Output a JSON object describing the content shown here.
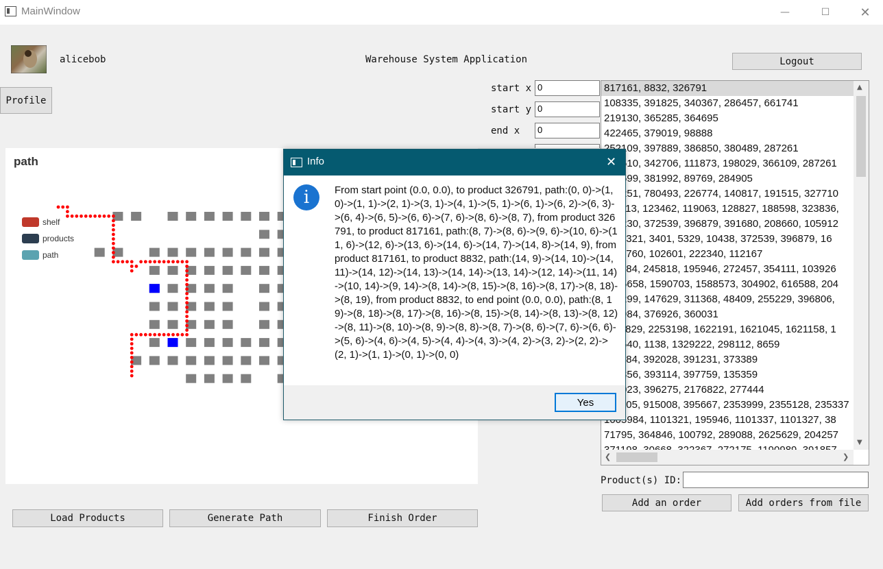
{
  "window": {
    "title": "MainWindow"
  },
  "user": {
    "name": "alicebob"
  },
  "header": {
    "app_title": "Warehouse System Application"
  },
  "buttons": {
    "logout": "Logout",
    "profile": "Profile",
    "load_products": "Load Products",
    "generate_path": "Generate Path",
    "finish_order": "Finish Order",
    "add_order": "Add an order",
    "add_orders_file": "Add orders from file"
  },
  "coords": {
    "start_x_label": "start x",
    "start_x_value": "0",
    "start_y_label": "start y",
    "start_y_value": "0",
    "end_x_label": "end x",
    "end_x_value": "0"
  },
  "product_id": {
    "label": "Product(s) ID:",
    "value": ""
  },
  "orders": [
    "817161, 8832, 326791",
    "108335, 391825, 340367, 286457, 661741",
    "219130, 365285, 364695",
    "422465, 379019, 98888",
    "252109, 397889, 386850, 380489, 287261",
    "202510, 342706, 111873, 198029, 366109, 287261",
    "301599, 381992, 89769, 284905",
    "101251, 780493, 226774, 140817, 191515, 327710",
    "101113, 123462, 119063, 128827, 188598, 323836,",
    "101230, 372539, 396879, 391680, 208660, 105912",
    "1101321, 3401, 5329, 10438, 372539, 396879, 16",
    "1197760, 102601, 222340, 112167",
    "101184, 245818, 195946, 272457, 354111, 103926",
    "1775658, 1590703, 1588573, 304902, 616588, 204",
    "101299, 147629, 311368, 48409, 255229, 396806,",
    "101984, 376926, 360031",
    "1112829, 2253198, 1622191, 1621045, 1621158, 1",
    "101540, 1138, 1329222, 298112, 8659",
    "101184, 392028, 391231, 373389",
    "101356, 393114, 397759, 135359",
    "101023, 396275, 2176822, 277444",
    "101105, 915008, 395667, 2353999, 2355128, 235337",
    "1005984, 1101321, 195946, 1101337, 1101327, 38",
    "71795, 364846, 100792, 289088, 2625629, 204257",
    "371198, 30668, 322367, 272175, 1190989, 391857"
  ],
  "chart_data": {
    "type": "scatter",
    "title": "path",
    "legend": [
      "shelf",
      "products",
      "path"
    ],
    "colors": {
      "shelf": "#808080",
      "products": "#0000ff",
      "path": "#ff0000",
      "legend_shelf": "#c0392b",
      "legend_products": "#2c3e50",
      "legend_path": "#5ba3b0"
    },
    "shelves": [
      [
        2,
        0
      ],
      [
        3,
        0
      ],
      [
        5,
        0
      ],
      [
        6,
        0
      ],
      [
        7,
        0
      ],
      [
        8,
        0
      ],
      [
        9,
        0
      ],
      [
        10,
        0
      ],
      [
        11,
        0
      ],
      [
        12,
        0
      ],
      [
        13,
        0
      ],
      [
        14,
        0
      ],
      [
        15,
        0
      ],
      [
        10,
        1
      ],
      [
        11,
        1
      ],
      [
        12,
        1
      ],
      [
        13,
        1
      ],
      [
        14,
        1
      ],
      [
        1,
        2
      ],
      [
        2,
        2
      ],
      [
        4,
        2
      ],
      [
        5,
        2
      ],
      [
        6,
        2
      ],
      [
        7,
        2
      ],
      [
        8,
        2
      ],
      [
        9,
        2
      ],
      [
        10,
        2
      ],
      [
        11,
        2
      ],
      [
        12,
        2
      ],
      [
        13,
        2
      ],
      [
        14,
        2
      ],
      [
        4,
        3
      ],
      [
        5,
        3
      ],
      [
        6,
        3
      ],
      [
        7,
        3
      ],
      [
        8,
        3
      ],
      [
        9,
        3
      ],
      [
        10,
        3
      ],
      [
        11,
        3
      ],
      [
        12,
        3
      ],
      [
        13,
        3
      ],
      [
        14,
        3
      ],
      [
        4,
        4
      ],
      [
        5,
        4
      ],
      [
        6,
        4
      ],
      [
        7,
        4
      ],
      [
        8,
        4
      ],
      [
        10,
        4
      ],
      [
        11,
        4
      ],
      [
        12,
        4
      ],
      [
        13,
        4
      ],
      [
        14,
        4
      ],
      [
        4,
        5
      ],
      [
        5,
        5
      ],
      [
        6,
        5
      ],
      [
        7,
        5
      ],
      [
        8,
        5
      ],
      [
        10,
        5
      ],
      [
        11,
        5
      ],
      [
        12,
        5
      ],
      [
        13,
        5
      ],
      [
        14,
        5
      ],
      [
        4,
        6
      ],
      [
        5,
        6
      ],
      [
        6,
        6
      ],
      [
        7,
        6
      ],
      [
        8,
        6
      ],
      [
        10,
        6
      ],
      [
        11,
        6
      ],
      [
        12,
        6
      ],
      [
        13,
        6
      ],
      [
        14,
        6
      ],
      [
        4,
        7
      ],
      [
        5,
        7
      ],
      [
        6,
        7
      ],
      [
        7,
        7
      ],
      [
        8,
        7
      ],
      [
        9,
        7
      ],
      [
        10,
        7
      ],
      [
        11,
        7
      ],
      [
        12,
        7
      ],
      [
        13,
        7
      ],
      [
        3,
        8
      ],
      [
        4,
        8
      ],
      [
        5,
        8
      ],
      [
        6,
        8
      ],
      [
        7,
        8
      ],
      [
        8,
        8
      ],
      [
        9,
        8
      ],
      [
        10,
        8
      ],
      [
        11,
        8
      ],
      [
        12,
        8
      ],
      [
        13,
        8
      ],
      [
        6,
        9
      ],
      [
        7,
        9
      ],
      [
        8,
        9
      ],
      [
        9,
        9
      ],
      [
        11,
        9
      ],
      [
        12,
        9
      ],
      [
        13,
        9
      ],
      [
        14,
        9
      ],
      [
        15,
        9
      ],
      [
        14,
        10
      ],
      [
        15,
        10
      ]
    ],
    "products": [
      [
        4,
        4
      ],
      [
        12,
        4
      ],
      [
        5,
        7
      ]
    ],
    "path": [
      [
        0,
        0
      ],
      [
        1,
        0
      ],
      [
        1,
        1
      ],
      [
        2,
        1
      ],
      [
        3,
        1
      ],
      [
        4,
        1
      ],
      [
        5,
        1
      ],
      [
        6,
        1
      ],
      [
        6,
        2
      ],
      [
        6,
        3
      ],
      [
        6,
        4
      ],
      [
        6,
        5
      ],
      [
        6,
        6
      ],
      [
        7,
        6
      ],
      [
        8,
        6
      ],
      [
        8,
        7
      ],
      [
        9,
        6
      ],
      [
        10,
        6
      ],
      [
        11,
        6
      ],
      [
        12,
        6
      ],
      [
        13,
        6
      ],
      [
        14,
        6
      ],
      [
        14,
        7
      ],
      [
        14,
        8
      ],
      [
        14,
        9
      ],
      [
        14,
        10
      ],
      [
        14,
        11
      ],
      [
        14,
        12
      ],
      [
        14,
        13
      ],
      [
        14,
        14
      ],
      [
        13,
        14
      ],
      [
        12,
        14
      ],
      [
        11,
        14
      ],
      [
        10,
        14
      ],
      [
        9,
        14
      ],
      [
        8,
        14
      ],
      [
        8,
        15
      ],
      [
        8,
        16
      ],
      [
        8,
        17
      ],
      [
        8,
        18
      ],
      [
        8,
        19
      ]
    ]
  },
  "dialog": {
    "title": "Info",
    "message": "From start point (0.0, 0.0), to product 326791, path:(0, 0)->(1, 0)->(1, 1)->(2, 1)->(3, 1)->(4, 1)->(5, 1)->(6, 1)->(6, 2)->(6, 3)->(6, 4)->(6, 5)->(6, 6)->(7, 6)->(8, 6)->(8, 7), from product 326791, to product 817161, path:(8, 7)->(8, 6)->(9, 6)->(10, 6)->(11, 6)->(12, 6)->(13, 6)->(14, 6)->(14, 7)->(14, 8)->(14, 9), from product 817161, to product 8832, path:(14, 9)->(14, 10)->(14, 11)->(14, 12)->(14, 13)->(14, 14)->(13, 14)->(12, 14)->(11, 14)->(10, 14)->(9, 14)->(8, 14)->(8, 15)->(8, 16)->(8, 17)->(8, 18)->(8, 19), from product 8832, to end point (0.0, 0.0), path:(8, 19)->(8, 18)->(8, 17)->(8, 16)->(8, 15)->(8, 14)->(8, 13)->(8, 12)->(8, 11)->(8, 10)->(8, 9)->(8, 8)->(8, 7)->(8, 6)->(7, 6)->(6, 6)->(5, 6)->(4, 6)->(4, 5)->(4, 4)->(4, 3)->(4, 2)->(3, 2)->(2, 2)->(2, 1)->(1, 1)->(0, 1)->(0, 0)",
    "yes_label": "Yes"
  }
}
